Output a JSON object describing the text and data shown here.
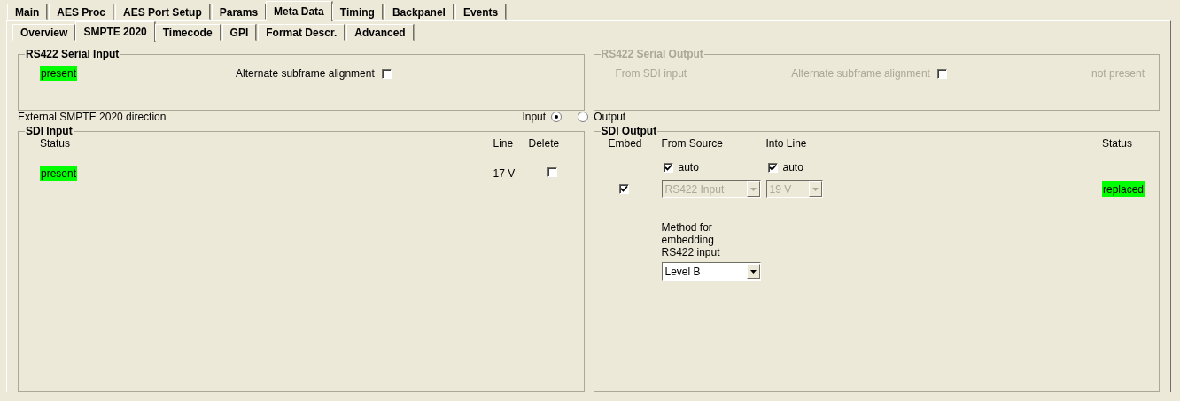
{
  "tabs": [
    {
      "label": "Main",
      "selected": false
    },
    {
      "label": "AES Proc",
      "selected": false
    },
    {
      "label": "AES Port Setup",
      "selected": false
    },
    {
      "label": "Params",
      "selected": false
    },
    {
      "label": "Meta Data",
      "selected": true
    },
    {
      "label": "Timing",
      "selected": false
    },
    {
      "label": "Backpanel",
      "selected": false
    },
    {
      "label": "Events",
      "selected": false
    }
  ],
  "subtabs": [
    {
      "label": "Overview",
      "selected": false
    },
    {
      "label": "SMPTE 2020",
      "selected": true
    },
    {
      "label": "Timecode",
      "selected": false
    },
    {
      "label": "GPI",
      "selected": false
    },
    {
      "label": "Format Descr.",
      "selected": false
    },
    {
      "label": "Advanced",
      "selected": false
    }
  ],
  "rs422_input": {
    "title": "RS422 Serial Input",
    "disabled": false,
    "status": {
      "text": "present",
      "color": "#00ff00"
    },
    "alternate": {
      "label": "Alternate subframe alignment",
      "checked": false
    }
  },
  "rs422_output": {
    "title": "RS422 Serial Output",
    "disabled": true,
    "source": "From SDI input",
    "alternate": {
      "label": "Alternate subframe alignment",
      "checked": false
    },
    "status": {
      "text": "not present"
    }
  },
  "direction": {
    "label": "External SMPTE 2020 direction",
    "options": [
      {
        "label": "Input",
        "selected": true,
        "kind": "label-left"
      },
      {
        "label": "Output",
        "selected": false,
        "kind": "label-right"
      }
    ]
  },
  "sdi_input": {
    "title": "SDI Input",
    "columns": [
      "Status",
      "Line",
      "Delete"
    ],
    "rows": [
      {
        "status": "present",
        "color": "#00ff00",
        "line": "17 V",
        "delete": false
      }
    ]
  },
  "sdi_output": {
    "title": "SDI Output",
    "columns": [
      "Embed",
      "From Source",
      "Into Line",
      "Status"
    ],
    "source_auto": {
      "label": "auto",
      "checked": true
    },
    "line_auto": {
      "label": "auto",
      "checked": true
    },
    "rows": [
      {
        "embed": true,
        "source": {
          "value": "RS422 Input",
          "disabled": true
        },
        "line": {
          "value": "19 V",
          "disabled": true
        },
        "status": "replaced",
        "color": "#00ff00"
      }
    ],
    "method": {
      "label": "Method for embedding RS422 input",
      "value": "Level B",
      "disabled": false
    }
  }
}
